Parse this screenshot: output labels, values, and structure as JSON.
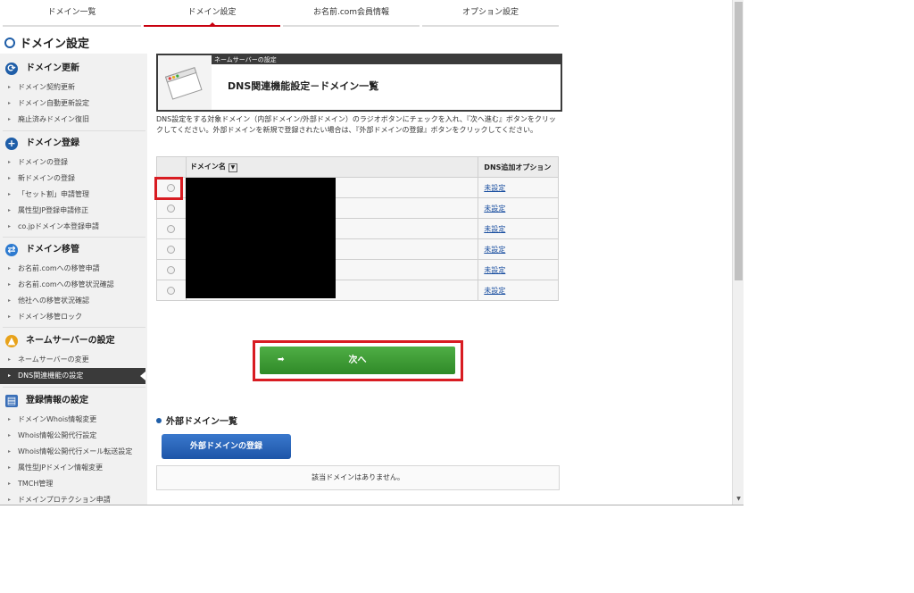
{
  "top_tabs": [
    {
      "label": "ドメイン一覧",
      "active": false
    },
    {
      "label": "ドメイン設定",
      "active": true
    },
    {
      "label": "お名前.com会員情報",
      "active": false
    },
    {
      "label": "オプション設定",
      "active": false
    }
  ],
  "page_title": "ドメイン設定",
  "sidebar": {
    "groups": [
      {
        "title": "ドメイン更新",
        "icon": "refresh-icon",
        "items": [
          "ドメイン契約更新",
          "ドメイン自動更新設定",
          "廃止済みドメイン復旧"
        ]
      },
      {
        "title": "ドメイン登録",
        "icon": "plus-circle-icon",
        "items": [
          "ドメインの登録",
          "新ドメインの登録",
          "「セット割」申請管理",
          "属性型JP登録申請修正",
          "co.jpドメイン本登録申請"
        ]
      },
      {
        "title": "ドメイン移管",
        "icon": "transfer-icon",
        "items": [
          "お名前.comへの移管申請",
          "お名前.comへの移管状況確認",
          "他社への移管状況確認",
          "ドメイン移管ロック"
        ]
      },
      {
        "title": "ネームサーバーの設定",
        "icon": "nameserver-icon",
        "items": [
          "ネームサーバーの変更",
          "DNS関連機能の設定"
        ]
      },
      {
        "title": "登録情報の設定",
        "icon": "book-icon",
        "items": [
          "ドメインWhois情報変更",
          "Whois情報公開代行設定",
          "Whois情報公開代行メール転送設定",
          "属性型JPドメイン情報変更",
          "TMCH管理",
          "ドメインプロテクション申請"
        ]
      }
    ],
    "active_item": "DNS関連機能の設定"
  },
  "header_card": {
    "band_label": "ネームサーバーの設定",
    "title": "DNS関連機能設定－ドメイン一覧"
  },
  "description": "DNS設定をする対象ドメイン（内部ドメイン/外部ドメイン）のラジオボタンにチェックを入れ、『次へ進む』ボタンをクリックしてください。外部ドメインを新規で登録されたい場合は、『外部ドメインの登録』ボタンをクリックしてください。",
  "table": {
    "col_name": "ドメイン名",
    "col_option": "DNS追加オプション",
    "sort_icon": "▼",
    "rows": [
      {
        "option": "未設定"
      },
      {
        "option": "未設定"
      },
      {
        "option": "未設定"
      },
      {
        "option": "未設定"
      },
      {
        "option": "未設定"
      },
      {
        "option": "未設定"
      }
    ]
  },
  "next_button": {
    "label": "次へ",
    "arrow": "➡"
  },
  "external": {
    "title": "外部ドメイン一覧",
    "register_button": "外部ドメインの登録",
    "empty_message": "該当ドメインはありません。"
  }
}
